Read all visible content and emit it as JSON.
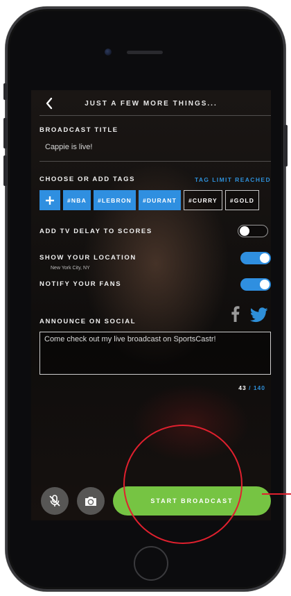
{
  "header": {
    "title": "JUST A FEW MORE THINGS...",
    "back_icon": "back-chevron-icon"
  },
  "broadcast_title": {
    "label": "BROADCAST TITLE",
    "value": "Cappie is live!"
  },
  "tags": {
    "label": "CHOOSE OR ADD TAGS",
    "limit_text": "TAG LIMIT REACHED",
    "add_label": "+",
    "items": [
      {
        "label": "#NBA",
        "selected": true
      },
      {
        "label": "#LEBRON",
        "selected": true
      },
      {
        "label": "#DURANT",
        "selected": true
      },
      {
        "label": "#CURRY",
        "selected": false
      },
      {
        "label": "#GOLD",
        "selected": false
      }
    ]
  },
  "settings": {
    "tv_delay": {
      "label": "ADD TV DELAY TO SCORES",
      "on": false
    },
    "location": {
      "label": "SHOW YOUR LOCATION",
      "sublabel": "New York City, NY",
      "on": true
    },
    "notify": {
      "label": "NOTIFY YOUR FANS",
      "on": true
    }
  },
  "social": {
    "label": "ANNOUNCE ON SOCIAL",
    "icons": [
      "facebook-icon",
      "twitter-icon"
    ],
    "message": "Come check out my live broadcast on SportsCastr!",
    "count": "43",
    "separator": " / ",
    "limit": "140"
  },
  "actions": {
    "mute_icon": "microphone-muted-icon",
    "camera_icon": "camera-switch-icon",
    "start_label": "START BROADCAST"
  },
  "colors": {
    "accent_blue": "#2f8fe0",
    "start_green": "#76c443",
    "annotation_red": "#e0202e"
  }
}
